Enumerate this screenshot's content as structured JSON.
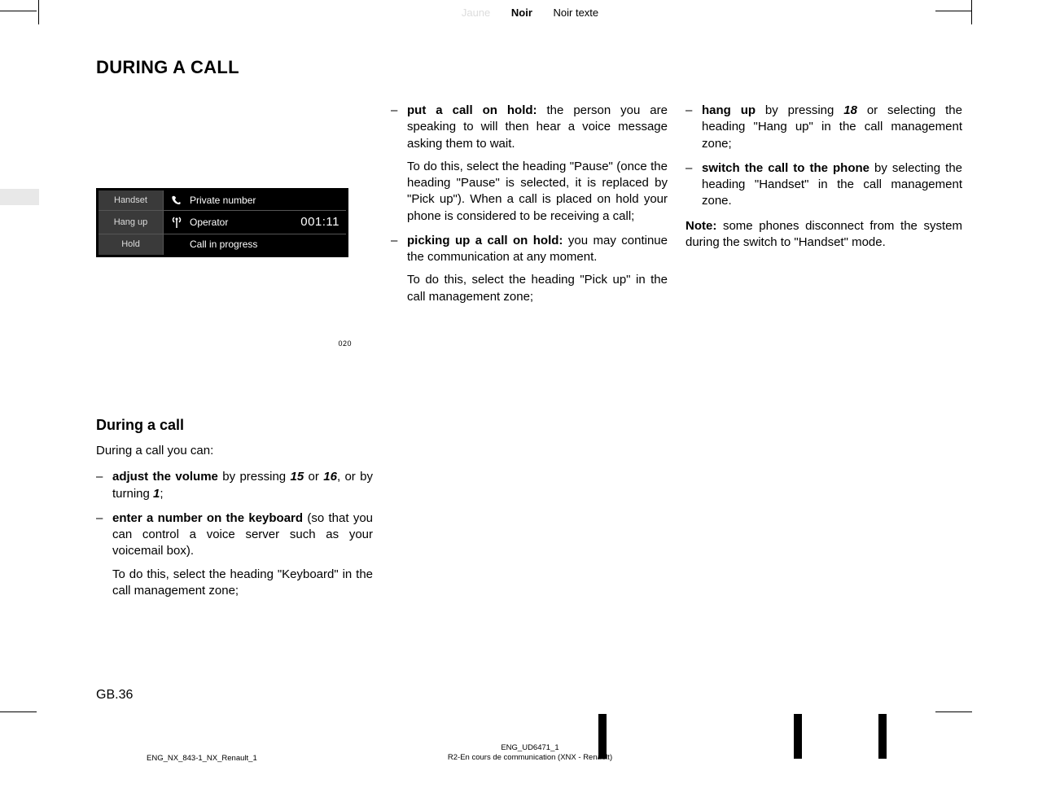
{
  "header_colors": {
    "jaune": "Jaune",
    "noir": "Noir",
    "noir_texte": "Noir texte"
  },
  "title": "DURING A CALL",
  "device": {
    "row1_btn": "Handset",
    "row1_text": "Private number",
    "row2_btn": "Hang up",
    "row2_text": "Operator",
    "row2_time": "001:11",
    "row3_btn": "Hold",
    "row3_text": "Call in progress"
  },
  "image_code": "020",
  "subhead": "During a call",
  "intro": "During a call you can:",
  "col1": {
    "i1_bold": "adjust the volume",
    "i1_a": " by pressing ",
    "i1_b15": "15",
    "i1_c": " or ",
    "i1_b16": "16",
    "i1_d": ", or  by turning  ",
    "i1_b1": "1",
    "i1_e": ";",
    "i2_bold": "enter a number on the keyboard",
    "i2_rest": " (so that you can control a voice server such as your voicemail box).",
    "i2_follow": "To do this, select the heading \"Keyboard\" in the call management zone;"
  },
  "col2": {
    "i1_bold": "put a call on hold:",
    "i1_rest": " the person you are speaking to will then hear a voice message asking them to wait.",
    "i1_follow": "To do this, select the heading \"Pause\" (once the heading \"Pause\" is selected, it is replaced by \"Pick up\"). When a call is placed on hold your phone is considered to be receiving a call;",
    "i2_bold": "picking up a call on hold:",
    "i2_rest": " you may continue the communication at any moment.",
    "i2_follow": "To do this, select the heading \"Pick up\" in the call management zone;"
  },
  "col3": {
    "i1_bold": "hang up",
    "i1_a": " by pressing  ",
    "i1_b18": "18",
    "i1_rest": " or selecting the heading \"Hang up\" in the call management zone;",
    "i2_bold": "switch the call to the phone",
    "i2_rest": " by selecting the heading \"Handset\" in the call management zone.",
    "note_bold": "Note:",
    "note_rest": " some phones disconnect from the system during the switch to \"Handset\" mode."
  },
  "page_num": "GB.36",
  "footer": {
    "left": "ENG_NX_843-1_NX_Renault_1",
    "center_l1": "ENG_UD6471_1",
    "center_l2": "R2-En cours de communication (XNX - Renault)"
  }
}
